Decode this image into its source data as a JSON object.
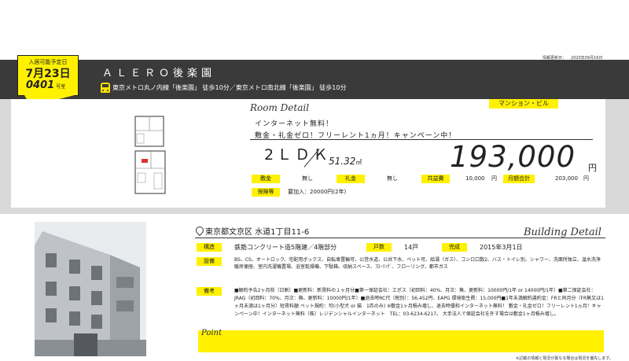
{
  "info_date": {
    "label": "情報更新日：",
    "value": "2020年09月16日"
  },
  "badge": {
    "label": "入居可能予定日",
    "date": "7月23日",
    "room_no": "0401",
    "room_suffix": "号室"
  },
  "property": {
    "name": "ＡＬＥＲＯ後楽園",
    "access": "東京メトロ丸ノ内線「後楽園」 徒歩10分／東京メトロ南北線「後楽園」 徒歩10分"
  },
  "detail": {
    "room_detail_label": "Room Detail",
    "category": "マンション・ビル",
    "catch1": "インターネット無料！",
    "catch2": "敷金・礼金ゼロ！フリーレント1ヵ月！キャンペーン中！",
    "layout": "2ＬＤＫ",
    "area": "51.32",
    "area_unit": "㎡",
    "rent": "193,000",
    "rent_unit": "円",
    "fees": {
      "deposit_label": "敷金",
      "deposit": "無し",
      "key_money_label": "礼金",
      "key_money": "無し",
      "common_label": "共益費",
      "common": "10,000",
      "monthly_label": "月額合計",
      "monthly": "203,000",
      "yen": "円"
    },
    "guarantee_label": "保険等",
    "guarantee": "要加入：20000円(2年)"
  },
  "building": {
    "address": "東京都文京区 水道1丁目11-6",
    "building_detail_label": "Building Detail",
    "structure_label": "構造",
    "structure": "鉄筋コンクリート造5階建／4階部分",
    "units_label": "戸数",
    "units": "14戸",
    "completed_label": "完成",
    "completed": "2015年3月1日",
    "facilities_label": "設備",
    "facilities": "BS、CS、オートロック、宅配用ボックス、自転車置輪可、公営水道、公共下水、ペット可、給湯（ガス）、コンロ口数2、バス・トイレ別、シャワー、洗面所独立、温水洗浄暖房便座、室内洗濯機置場、浴室乾燥機、下駄箱、収納スペース、ﾌﾛｰﾘﾝｸﾞ、フローリング、都市ガス",
    "remarks_label": "備考",
    "remarks": "■解約予告2ヶ月前（日割）■更新料：新賃料の１ヶ月分■第一保証会社：エポス（初回料：40%、月次：無、更新料：10000円/1年 or 14000円/1年）■第二保証会社：JRAG（初回料：70%、月次：無、更新料：10000円/1年）■退去時RC代（税別）：56,452円、EAPG 環境衛生費：15,000円■1年未満解約違約金：FRと同月分（FR無又は1ヶ月未満は1ヶ月分）短賃料額 ペット規約：可(小型犬 or 猫　1匹のみ) ※敷金1ヶ月積み増し、退去時優和インターネット無料！ 敷金・礼金ゼロ！フリーレント1ヵ月！キャンペーン中！インターネット無料（株）レジデンシャルインターネット　TEL：03-6234-6217。 大手法人で保証会社を外す場合は敷金1ヶ月積み増し。"
  },
  "point_label": "Point",
  "footnote": "※記載の情報と現況が異なる場合は現況を優先します。"
}
